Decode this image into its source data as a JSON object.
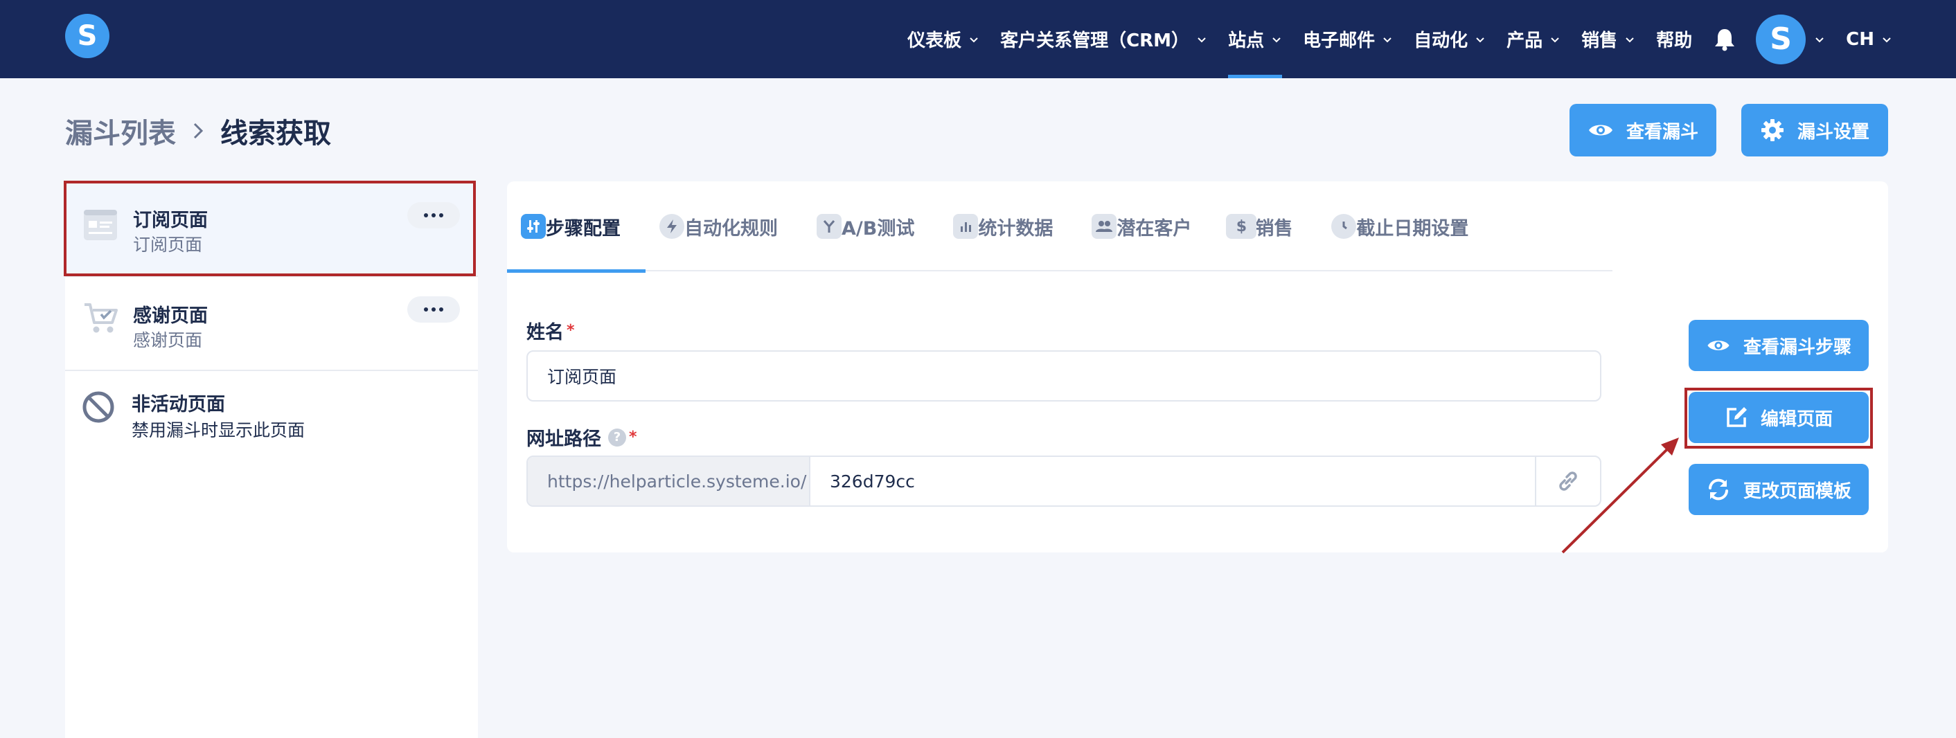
{
  "nav": {
    "logo_letter": "S",
    "items": [
      {
        "label": "仪表板",
        "chevron": true
      },
      {
        "label": "客户关系管理（CRM）",
        "chevron": true
      },
      {
        "label": "站点",
        "chevron": true,
        "active": true
      },
      {
        "label": "电子邮件",
        "chevron": true
      },
      {
        "label": "自动化",
        "chevron": true
      },
      {
        "label": "产品",
        "chevron": true
      },
      {
        "label": "销售",
        "chevron": true
      },
      {
        "label": "帮助",
        "chevron": false
      }
    ],
    "avatar_letter": "S",
    "language": "CH",
    "icons": [
      "bell-icon",
      "chevron-down-icon"
    ]
  },
  "breadcrumb": {
    "root": "漏斗列表",
    "current": "线索获取"
  },
  "header_buttons": {
    "view_funnel": "查看漏斗",
    "funnel_settings": "漏斗设置"
  },
  "pages": [
    {
      "title": "订阅页面",
      "subtitle": "订阅页面",
      "icon": "page-layout-icon",
      "selected": true
    },
    {
      "title": "感谢页面",
      "subtitle": "感谢页面",
      "icon": "cart-check-icon",
      "selected": false
    },
    {
      "title": "非活动页面",
      "subtitle": "禁用漏斗时显示此页面",
      "icon": "ban-icon",
      "selected": false
    }
  ],
  "tabs": [
    {
      "label": "步骤配置",
      "icon": "sliders-icon",
      "active": true
    },
    {
      "label": "自动化规则",
      "icon": "bolt-icon"
    },
    {
      "label": "A/B测试",
      "icon": "split-icon"
    },
    {
      "label": "统计数据",
      "icon": "bar-chart-icon"
    },
    {
      "label": "潜在客户",
      "icon": "users-icon"
    },
    {
      "label": "销售",
      "icon": "dollar-icon"
    },
    {
      "label": "截止日期设置",
      "icon": "clock-icon"
    }
  ],
  "form": {
    "name_label": "姓名",
    "name_value": "订阅页面",
    "path_label": "网址路径",
    "help_mark": "?",
    "required_mark": "*",
    "url_prefix": "https://helparticle.systeme.io/",
    "url_slug": "326d79cc"
  },
  "side_buttons": {
    "view_step": "查看漏斗步骤",
    "edit_page": "编辑页面",
    "change_template": "更改页面模板"
  },
  "colors": {
    "nav_bg": "#18295b",
    "accent": "#3f9cf0",
    "highlight": "#b0282a"
  }
}
